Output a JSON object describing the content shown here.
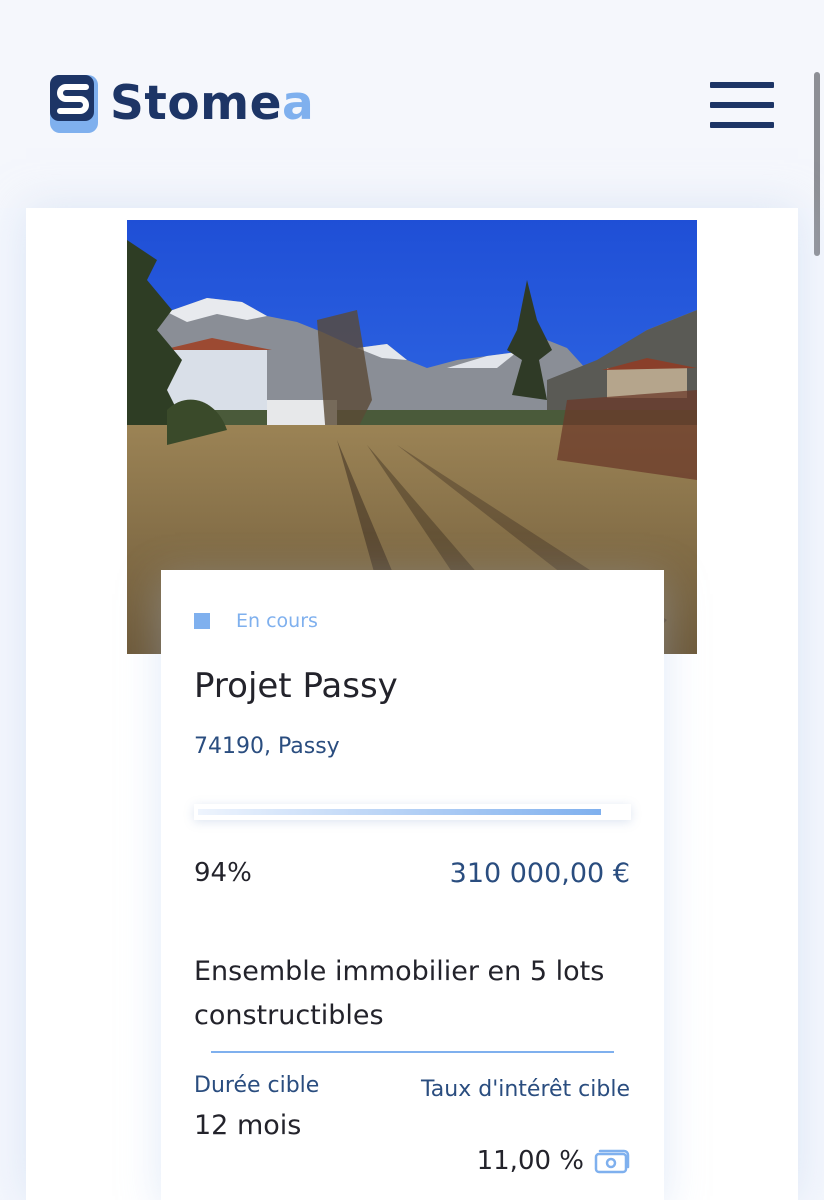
{
  "header": {
    "logo_text_main": "Stome",
    "logo_text_accent": "a",
    "logo_icon": "stomea-logo-icon",
    "menu_icon": "hamburger-menu-icon"
  },
  "project": {
    "status": "En cours",
    "title": "Projet Passy",
    "location": "74190, Passy",
    "progress_percent": 94,
    "progress_label": "94%",
    "amount": "310 000,00 €",
    "description": "Ensemble immobilier en 5 lots constructibles",
    "duration_label": "Durée cible",
    "duration_value": "12 mois",
    "rate_label": "Taux d'intérêt cible",
    "rate_value": "11,00 %",
    "rate_icon": "money-icon"
  },
  "colors": {
    "brand_dark": "#1d3566",
    "brand_light": "#7fb0ee",
    "text_blue": "#2a4d7f"
  }
}
